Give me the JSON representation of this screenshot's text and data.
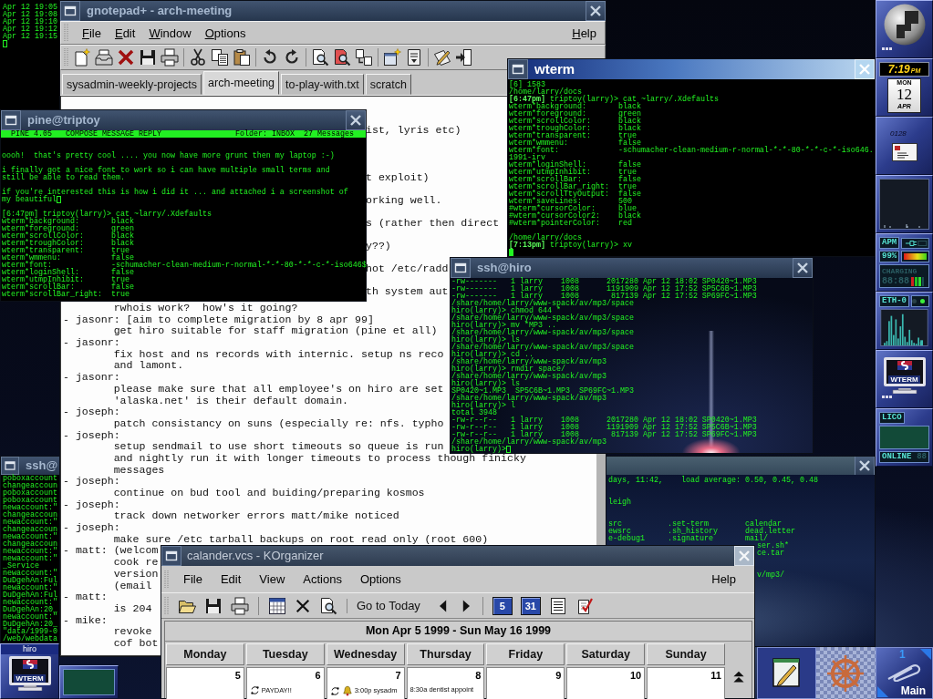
{
  "log_terminal": {
    "active": false,
    "lines": [
      "Apr 12 19:05",
      "Apr 12 19:08",
      "Apr 12 19:10",
      "Apr 12 19:12",
      "Apr 12 19:15"
    ],
    "cursor": {
      "own_line": true
    }
  },
  "left_terminal": {
    "title": "ssh@",
    "active": false,
    "lines": [
      "poboxaccount",
      "changeaccoun",
      "poboxaccount",
      "poboxaccount",
      "newaccount:\"",
      "changeaccoun",
      "newaccount:\"",
      "changeaccoun",
      "newaccount:\"",
      "changeaccoun",
      "newaccount:\"",
      "newaccount:\"",
      "_Service",
      "newaccount:\"",
      "DuDgehAn:Ful",
      "newaccount:\"",
      "DuDgehAn:Ful",
      "newaccount:\"",
      "DuDgehAn:20_",
      "newaccount:\"",
      "DuDgehAn:20_",
      "\"data/1999-0",
      "/web/webdata"
    ]
  },
  "background_terminal": {
    "active": false,
    "close_button": true,
    "blocks": [
      [
        {
          "kind": "line",
          "text": "days, 11:42,    load average: 0.50, 0.45, 0.48"
        }
      ],
      [
        {
          "kind": "line",
          "text": "leigh"
        }
      ],
      [
        {
          "kind": "line",
          "text": "src          .set-term        calendar"
        },
        {
          "kind": "line",
          "text": "ewsrc        .sh_history      dead.letter"
        },
        {
          "kind": "line",
          "text": "e-debug1     .signature       mail/"
        },
        {
          "kind": "partial",
          "text": "ser.sh*"
        },
        {
          "kind": "partial",
          "text": "ce.tar"
        }
      ],
      [
        {
          "kind": "partial",
          "text": "v/mp3/"
        }
      ]
    ]
  },
  "gnotepad": {
    "title": "gnotepad+ - arch-meeting",
    "active": false,
    "close_button": true,
    "menu": [
      "File",
      "Edit",
      "Window",
      "Options"
    ],
    "help": "Help",
    "tabs": [
      {
        "label": "sysadmin-weekly-projects",
        "selected": false
      },
      {
        "label": "arch-meeting",
        "selected": true
      },
      {
        "label": "to-play-with.txt",
        "selected": false
      },
      {
        "label": "scratch",
        "selected": false
      }
    ],
    "lines": [
      {
        "kind": "partial",
        "text": "ist, lyris etc)"
      },
      {
        "kind": "partial",
        "text": "t exploit)"
      },
      {
        "kind": "partial",
        "text": "orking well."
      },
      {
        "kind": "partial",
        "text": "s (rather then direct"
      },
      {
        "kind": "partial",
        "text": "y??)"
      },
      {
        "kind": "partial",
        "text": "hot /etc/radd"
      },
      {
        "kind": "partial",
        "text": "th system aut"
      },
      {
        "kind": "indent",
        "text": "rwhois work?  how's it going?"
      },
      {
        "kind": "entry",
        "text": "- jasonr: [aim to complete migration by 8 apr 99]"
      },
      {
        "kind": "indent",
        "text": "get hiro suitable for staff migration (pine et all)"
      },
      {
        "kind": "entry",
        "text": "- jasonr:"
      },
      {
        "kind": "indent",
        "text": "fix host and ns records with internic. setup ns reco"
      },
      {
        "kind": "indent",
        "text": "and lamont."
      },
      {
        "kind": "entry",
        "text": "- jasonr:"
      },
      {
        "kind": "indent",
        "text": "please make sure that all employee's on hiro are set"
      },
      {
        "kind": "indent",
        "text": "'alaska.net' is their default domain."
      },
      {
        "kind": "entry",
        "text": "- joseph:"
      },
      {
        "kind": "indent",
        "text": "patch consistancy on suns (especially re: nfs. typho"
      },
      {
        "kind": "entry",
        "text": "- joseph:"
      },
      {
        "kind": "indent",
        "text": "setup sendmail to use short timeouts so queue is run"
      },
      {
        "kind": "indent",
        "text": "and nightly run it with longer timeouts to process though finicky"
      },
      {
        "kind": "indent",
        "text": "messages"
      },
      {
        "kind": "entry",
        "text": "- joseph:"
      },
      {
        "kind": "indent",
        "text": "continue on bud tool and buiding/preparing kosmos"
      },
      {
        "kind": "entry",
        "text": "- joseph:"
      },
      {
        "kind": "indent",
        "text": "track down networker errors matt/mike noticed"
      },
      {
        "kind": "entry",
        "text": "- joseph:"
      },
      {
        "kind": "indent",
        "text": "make sure /etc tarball backups on root read only (root 600)"
      },
      {
        "kind": "entry",
        "text": "- matt: (welcom"
      },
      {
        "kind": "indent",
        "text": "cook re"
      },
      {
        "kind": "indent",
        "text": "version"
      },
      {
        "kind": "indent",
        "text": "(email"
      },
      {
        "kind": "entry",
        "text": "- matt:"
      },
      {
        "kind": "indent",
        "text": "is 204"
      },
      {
        "kind": "entry",
        "text": "- mike:"
      },
      {
        "kind": "indent",
        "text": "revoke"
      },
      {
        "kind": "indent",
        "text": "cof bot"
      }
    ]
  },
  "pine": {
    "title": "pine@triptoy",
    "active": false,
    "close_button": true,
    "status_left": "PINE 4.05   COMPOSE MESSAGE REPLY",
    "status_right": "Folder: INBOX  27 Messages",
    "paragraphs": [
      {
        "lines": [
          "oooh!  that's pretty cool .... you now have more grunt then my laptop :-)"
        ],
        "cursor": false
      },
      {
        "lines": [
          "i finally got a nice font to work so i can have multiple small terms and",
          "still be able to read them."
        ],
        "cursor": false
      },
      {
        "lines": [
          "if you're interested this is how i did it ... and attached i a screenshot of",
          "my beautiful"
        ],
        "cursor": true
      },
      {
        "lines": [
          "[6:47pm] triptoy(larry)> cat ~larry/.Xdefaults",
          "wterm*background:       black",
          "wterm*foreground:       green",
          "wterm*scrollColor:      black",
          "wterm*troughColor:      black",
          "wterm*transparent:      true",
          "wterm*wmmenu:           false",
          "wterm*font:             -schumacher-clean-medium-r-normal-*-*-80-*-*-c-*-iso646$",
          "wterm*loginShell:       false",
          "wterm*utmpInhibit:      true",
          "wterm*scrollBar:        false",
          "wterm*scrollBar_right:  true"
        ],
        "cursor": false
      }
    ]
  },
  "wterm": {
    "title": "wterm",
    "active": true,
    "close_button": true,
    "blocks": [
      [
        {
          "kind": "line",
          "text": "[6] 1583"
        },
        {
          "kind": "line",
          "text": "/home/larry/docs"
        },
        {
          "kind": "prompt",
          "text": "**[6:47pm]** triptoy(larry)> cat ~larry/.Xdefaults"
        },
        {
          "kind": "line",
          "text": "wterm*background:       black"
        },
        {
          "kind": "line",
          "text": "wterm*foreground:       green"
        },
        {
          "kind": "line",
          "text": "wterm*scrollColor:      black"
        },
        {
          "kind": "line",
          "text": "wterm*troughColor:      black"
        },
        {
          "kind": "line",
          "text": "wterm*transparent:      true"
        },
        {
          "kind": "line",
          "text": "wterm*wmmenu:           false"
        },
        {
          "kind": "line",
          "text": "wterm*font:             -schumacher-clean-medium-r-normal-*-*-80-*-*-c-*-iso646."
        },
        {
          "kind": "line",
          "text": "1991-irv"
        },
        {
          "kind": "line",
          "text": "wterm*loginShell:       false"
        },
        {
          "kind": "line",
          "text": "wterm*utmpInhibit:      true"
        },
        {
          "kind": "line",
          "text": "wterm*scrollBar:        false"
        },
        {
          "kind": "line",
          "text": "wterm*scrollBar_right:  true"
        },
        {
          "kind": "line",
          "text": "wterm*scrollTtyOutput:  false"
        },
        {
          "kind": "line",
          "text": "wterm*saveLines:        500"
        },
        {
          "kind": "line",
          "text": "#wterm*cursorColor:     blue"
        },
        {
          "kind": "line",
          "text": "#wterm*cursorColor2:    black"
        },
        {
          "kind": "line",
          "text": "#wterm*pointerColor:    red"
        }
      ],
      [
        {
          "kind": "line",
          "text": "/home/larry/docs"
        },
        {
          "kind": "prompt",
          "text": "**[7:13pm]** triptoy(larry)> xv"
        }
      ]
    ],
    "cursor": {
      "own_line": true
    }
  },
  "ssh": {
    "title": "ssh@hiro",
    "active": false,
    "close_button": true,
    "lines": [
      "-rw-------   1 larry    1008      2017280 Apr 12 18:02 SP0420~1.MP3",
      "-rw-------   1 larry    1008      1191909 Apr 12 17:52 SP5C6B~1.MP3",
      "-rw-------   1 larry    1008       817139 Apr 12 17:52 SP69FC~1.MP3",
      "/share/home/larry/www-spack/av/mp3/space",
      "hiro(larry)> chmod 644 *",
      "/share/home/larry/www-spack/av/mp3/space",
      "hiro(larry)> mv *MP3 ..",
      "/share/home/larry/www-spack/av/mp3/space",
      "hiro(larry)> ls",
      "/share/home/larry/www-spack/av/mp3/space",
      "hiro(larry)> cd ..",
      "/share/home/larry/www-spack/av/mp3",
      "hiro(larry)> rmdir space/",
      "/share/home/larry/www-spack/av/mp3",
      "hiro(larry)> ls",
      "SP0420~1.MP3  SP5C6B~1.MP3  SP69FC~1.MP3",
      "/share/home/larry/www-spack/av/mp3",
      "hiro(larry)> l",
      "total 3948",
      "-rw-r--r--   1 larry    1008      2017280 Apr 12 18:02 SP0420~1.MP3",
      "-rw-r--r--   1 larry    1008      1191909 Apr 12 17:52 SP5C6B~1.MP3",
      "-rw-r--r--   1 larry    1008       817139 Apr 12 17:52 SP69FC~1.MP3",
      "/share/home/larry/www-spack/av/mp3",
      "hiro(larry)>"
    ],
    "cursor": {
      "own_line": false
    }
  },
  "korganizer": {
    "title": "calander.vcs - KOrganizer",
    "active": false,
    "close_button": true,
    "menu": [
      "File",
      "Edit",
      "View",
      "Actions",
      "Options"
    ],
    "help": "Help",
    "today_button": "Go to Today",
    "view_buttons": [
      "5",
      "31"
    ],
    "range": "Mon Apr 5 1999 - Sun May 16 1999",
    "days": [
      {
        "name": "Monday",
        "date": "5"
      },
      {
        "name": "Tuesday",
        "date": "6",
        "events": [
          {
            "text": "PAYDAY!!",
            "recurring": true,
            "alarm": false
          }
        ]
      },
      {
        "name": "Wednesday",
        "date": "7",
        "events": [
          {
            "text": "3:00p sysadm",
            "recurring": true,
            "alarm": true
          }
        ]
      },
      {
        "name": "Thursday",
        "date": "8",
        "events": [
          {
            "text": "8:30a dentist appoint",
            "recurring": false,
            "alarm": false
          }
        ]
      },
      {
        "name": "Friday",
        "date": "9"
      },
      {
        "name": "Saturday",
        "date": "10"
      },
      {
        "name": "Sunday",
        "date": "11"
      }
    ]
  },
  "dock": {
    "clock": {
      "time": "7:19",
      "meridiem": "PM",
      "weekday": "MON",
      "day": "12",
      "month": "APR"
    },
    "mail": {
      "count": "0128"
    },
    "battery": {
      "label": "APM",
      "percent": "99%",
      "level": 0.99,
      "status": "CHARGING",
      "status_lit": false,
      "time": "88:88",
      "time_lit": false
    },
    "network": {
      "label": "ETH-0",
      "leds": [
        {
          "on": false
        },
        {
          "on": true
        }
      ]
    },
    "terminal": {
      "label": "WTERM"
    },
    "modem": {
      "label": "LICO",
      "status": "ONLINE",
      "status_lit": true,
      "counter": "88",
      "counter_lit": false
    }
  },
  "shelf": {
    "host": "hiro",
    "label": "WTERM"
  },
  "workspace": {
    "number": "1",
    "name": "Main"
  }
}
